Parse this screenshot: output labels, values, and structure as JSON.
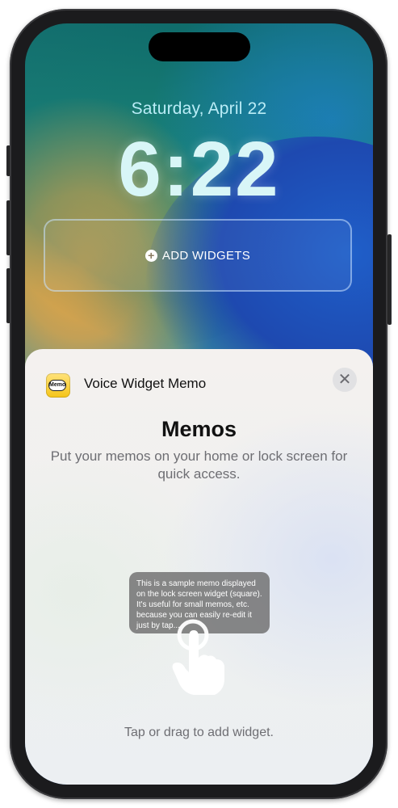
{
  "lock_screen": {
    "date": "Saturday, April 22",
    "time": "6:22",
    "add_widgets_label": "ADD WIDGETS",
    "add_widgets_icon": "plus-circle-icon"
  },
  "sheet": {
    "app_icon_text": "Memo",
    "app_name": "Voice Widget Memo",
    "close_icon": "close-icon",
    "title": "Memos",
    "description": "Put your memos on your home or lock screen for quick access.",
    "widget_preview_text": "This is a sample memo displayed on the lock screen widget (square). It's useful for small memos, etc. because you can easily re-edit it just by tap...",
    "footer": "Tap or drag to add widget."
  },
  "colors": {
    "accent_date": "#b9ecf6",
    "sheet_background": "#f4f1ef",
    "widget_preview": "#6e6e6e"
  }
}
